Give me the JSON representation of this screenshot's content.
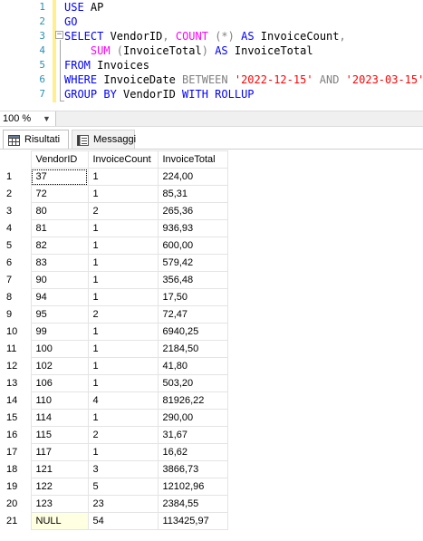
{
  "editor": {
    "line_numbers": [
      "1",
      "2",
      "3",
      "4",
      "5",
      "6",
      "7"
    ],
    "lines": [
      {
        "t1": "USE",
        "t2": " AP"
      },
      {
        "t1": "GO"
      },
      {
        "t1": "SELECT",
        "t2": " VendorID",
        "t3": ",",
        "t4": " COUNT",
        "t5": " (*)",
        "t6": " AS",
        "t7": " InvoiceCount",
        "t8": ","
      },
      {
        "t1": "    SUM",
        "t2": " (",
        "t3": "InvoiceTotal",
        "t4": ")",
        "t5": " AS",
        "t6": " InvoiceTotal"
      },
      {
        "t1": "FROM",
        "t2": " Invoices"
      },
      {
        "t1": "WHERE",
        "t2": " InvoiceDate ",
        "t3": "BETWEEN",
        "t4": " '2022-12-15'",
        "t5": " AND",
        "t6": " '2023-03-15'"
      },
      {
        "t1": "GROUP BY",
        "t2": " VendorID ",
        "t3": "WITH ROLLUP"
      }
    ]
  },
  "zoom": {
    "value": "100 %"
  },
  "tabs": {
    "results": "Risultati",
    "messages": "Messaggi"
  },
  "grid": {
    "columns": [
      "VendorID",
      "InvoiceCount",
      "InvoiceTotal"
    ],
    "rows": [
      {
        "n": "1",
        "v": "37",
        "c": "1",
        "t": "224,00"
      },
      {
        "n": "2",
        "v": "72",
        "c": "1",
        "t": "85,31"
      },
      {
        "n": "3",
        "v": "80",
        "c": "2",
        "t": "265,36"
      },
      {
        "n": "4",
        "v": "81",
        "c": "1",
        "t": "936,93"
      },
      {
        "n": "5",
        "v": "82",
        "c": "1",
        "t": "600,00"
      },
      {
        "n": "6",
        "v": "83",
        "c": "1",
        "t": "579,42"
      },
      {
        "n": "7",
        "v": "90",
        "c": "1",
        "t": "356,48"
      },
      {
        "n": "8",
        "v": "94",
        "c": "1",
        "t": "17,50"
      },
      {
        "n": "9",
        "v": "95",
        "c": "2",
        "t": "72,47"
      },
      {
        "n": "10",
        "v": "99",
        "c": "1",
        "t": "6940,25"
      },
      {
        "n": "11",
        "v": "100",
        "c": "1",
        "t": "2184,50"
      },
      {
        "n": "12",
        "v": "102",
        "c": "1",
        "t": "41,80"
      },
      {
        "n": "13",
        "v": "106",
        "c": "1",
        "t": "503,20"
      },
      {
        "n": "14",
        "v": "110",
        "c": "4",
        "t": "81926,22"
      },
      {
        "n": "15",
        "v": "114",
        "c": "1",
        "t": "290,00"
      },
      {
        "n": "16",
        "v": "115",
        "c": "2",
        "t": "31,67"
      },
      {
        "n": "17",
        "v": "117",
        "c": "1",
        "t": "16,62"
      },
      {
        "n": "18",
        "v": "121",
        "c": "3",
        "t": "3866,73"
      },
      {
        "n": "19",
        "v": "122",
        "c": "5",
        "t": "12102,96"
      },
      {
        "n": "20",
        "v": "123",
        "c": "23",
        "t": "2384,55"
      },
      {
        "n": "21",
        "v": "NULL",
        "c": "54",
        "t": "113425,97"
      }
    ]
  }
}
